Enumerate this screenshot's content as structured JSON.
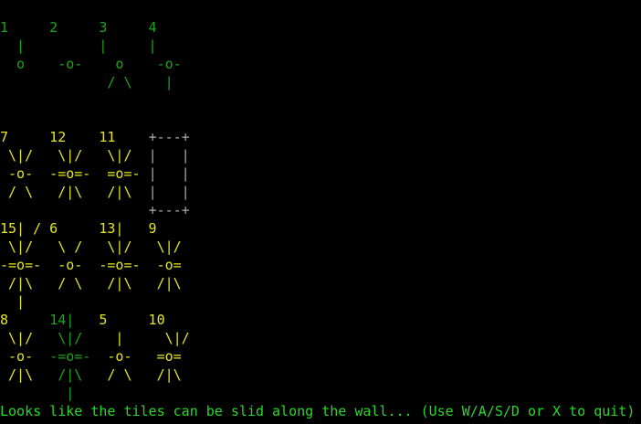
{
  "colors": {
    "background": "#000000",
    "green": "#19a519",
    "yellow": "#e6e61e",
    "gray": "#a8a8a8",
    "status_green": "#28d828"
  },
  "board": {
    "rows": [
      [
        {
          "t": "1     2     3     4",
          "c": "green"
        }
      ],
      [
        {
          "t": "  |         |     |",
          "c": "green"
        }
      ],
      [
        {
          "t": "  o    -o-    o    -o-",
          "c": "green"
        }
      ],
      [
        {
          "t": "             / \\    |",
          "c": "green"
        }
      ],
      [
        {
          "t": "",
          "c": "green"
        }
      ],
      [
        {
          "t": "",
          "c": "green"
        }
      ],
      [
        {
          "t": "7     12    11    ",
          "c": "yellow"
        },
        {
          "t": "+---+",
          "c": "gray"
        }
      ],
      [
        {
          "t": " \\|/   \\|/   \\|/  ",
          "c": "yellow"
        },
        {
          "t": "|   |",
          "c": "gray"
        }
      ],
      [
        {
          "t": " -o-  -=o=-  =o=- ",
          "c": "yellow"
        },
        {
          "t": "|   |",
          "c": "gray"
        }
      ],
      [
        {
          "t": " / \\   /|\\   /|\\  ",
          "c": "yellow"
        },
        {
          "t": "|   |",
          "c": "gray"
        }
      ],
      [
        {
          "t": "                  ",
          "c": "yellow"
        },
        {
          "t": "+---+",
          "c": "gray"
        }
      ],
      [
        {
          "t": "15| / 6     13|   9",
          "c": "yellow"
        }
      ],
      [
        {
          "t": " \\|/   \\ /   \\|/   \\|/",
          "c": "yellow"
        }
      ],
      [
        {
          "t": "-=o=-  -o-  -=o=-  -o=",
          "c": "yellow"
        }
      ],
      [
        {
          "t": " /|\\   / \\   /|\\   /|\\",
          "c": "yellow"
        }
      ],
      [
        {
          "t": "  |",
          "c": "yellow"
        }
      ],
      [
        {
          "t": "8     ",
          "c": "yellow"
        },
        {
          "t": "14|",
          "c": "green"
        },
        {
          "t": "   5     10",
          "c": "yellow"
        }
      ],
      [
        {
          "t": " \\|/  ",
          "c": "yellow"
        },
        {
          "t": " \\|/",
          "c": "green"
        },
        {
          "t": "    |     \\|/",
          "c": "yellow"
        }
      ],
      [
        {
          "t": " -o-  ",
          "c": "yellow"
        },
        {
          "t": "-=o=-",
          "c": "green"
        },
        {
          "t": "  -o-   =o=",
          "c": "yellow"
        }
      ],
      [
        {
          "t": " /|\\  ",
          "c": "yellow"
        },
        {
          "t": " /|\\",
          "c": "green"
        },
        {
          "t": "   / \\   /|\\",
          "c": "yellow"
        }
      ],
      [
        {
          "t": "      ",
          "c": "yellow"
        },
        {
          "t": "  |",
          "c": "green"
        }
      ]
    ]
  },
  "status": {
    "message": "Looks like the tiles can be slid along the wall... (Use W/A/S/D or X to quit)"
  }
}
